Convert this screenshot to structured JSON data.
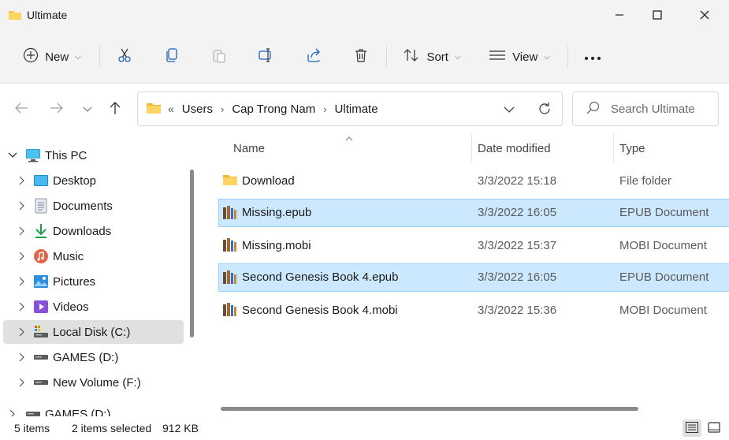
{
  "window": {
    "title": "Ultimate",
    "controls": {
      "minimize": "minimize-icon",
      "maximize": "maximize-icon",
      "close": "close-icon"
    }
  },
  "toolbar": {
    "new_label": "New",
    "sort_label": "Sort",
    "view_label": "View",
    "icons": [
      "plus-icon",
      "cut-icon",
      "copy-icon",
      "paste-icon",
      "rename-icon",
      "share-icon",
      "delete-icon",
      "sort-icon",
      "view-icon",
      "more-icon"
    ]
  },
  "address": {
    "overflow": "«",
    "crumbs": [
      "Users",
      "Cap Trong Nam",
      "Ultimate"
    ],
    "separator": "›"
  },
  "search": {
    "placeholder": "Search Ultimate"
  },
  "sidebar": {
    "items": [
      {
        "label": "This PC",
        "icon": "computer-icon",
        "expanded": true
      },
      {
        "label": "Desktop",
        "icon": "desktop-icon"
      },
      {
        "label": "Documents",
        "icon": "documents-icon"
      },
      {
        "label": "Downloads",
        "icon": "downloads-icon"
      },
      {
        "label": "Music",
        "icon": "music-icon"
      },
      {
        "label": "Pictures",
        "icon": "pictures-icon"
      },
      {
        "label": "Videos",
        "icon": "videos-icon"
      },
      {
        "label": "Local Disk (C:)",
        "icon": "local-disk-icon",
        "selected": true
      },
      {
        "label": "GAMES (D:)",
        "icon": "drive-icon"
      },
      {
        "label": "New Volume (F:)",
        "icon": "drive-icon"
      },
      {
        "label": "GAMES (D:)",
        "icon": "drive-icon"
      }
    ]
  },
  "columns": {
    "name": "Name",
    "date": "Date modified",
    "type": "Type"
  },
  "files": [
    {
      "name": "Download",
      "date": "3/3/2022 15:18",
      "type": "File folder",
      "icon": "folder-icon",
      "selected": false
    },
    {
      "name": "Missing.epub",
      "date": "3/3/2022 16:05",
      "type": "EPUB Document",
      "icon": "ebook-icon",
      "selected": true
    },
    {
      "name": "Missing.mobi",
      "date": "3/3/2022 15:37",
      "type": "MOBI Document",
      "icon": "ebook-icon",
      "selected": false
    },
    {
      "name": "Second Genesis Book 4.epub",
      "date": "3/3/2022 16:05",
      "type": "EPUB Document",
      "icon": "ebook-icon",
      "selected": true
    },
    {
      "name": "Second Genesis Book 4.mobi",
      "date": "3/3/2022 15:36",
      "type": "MOBI Document",
      "icon": "ebook-icon",
      "selected": false
    }
  ],
  "status": {
    "item_count": "5 items",
    "selection": "2 items selected",
    "size": "912 KB"
  },
  "colors": {
    "chrome_bg": "#f3f3f3",
    "selection_bg": "#cce8ff",
    "selection_border": "#99d1ff",
    "folder_yellow": "#f7c64a"
  }
}
